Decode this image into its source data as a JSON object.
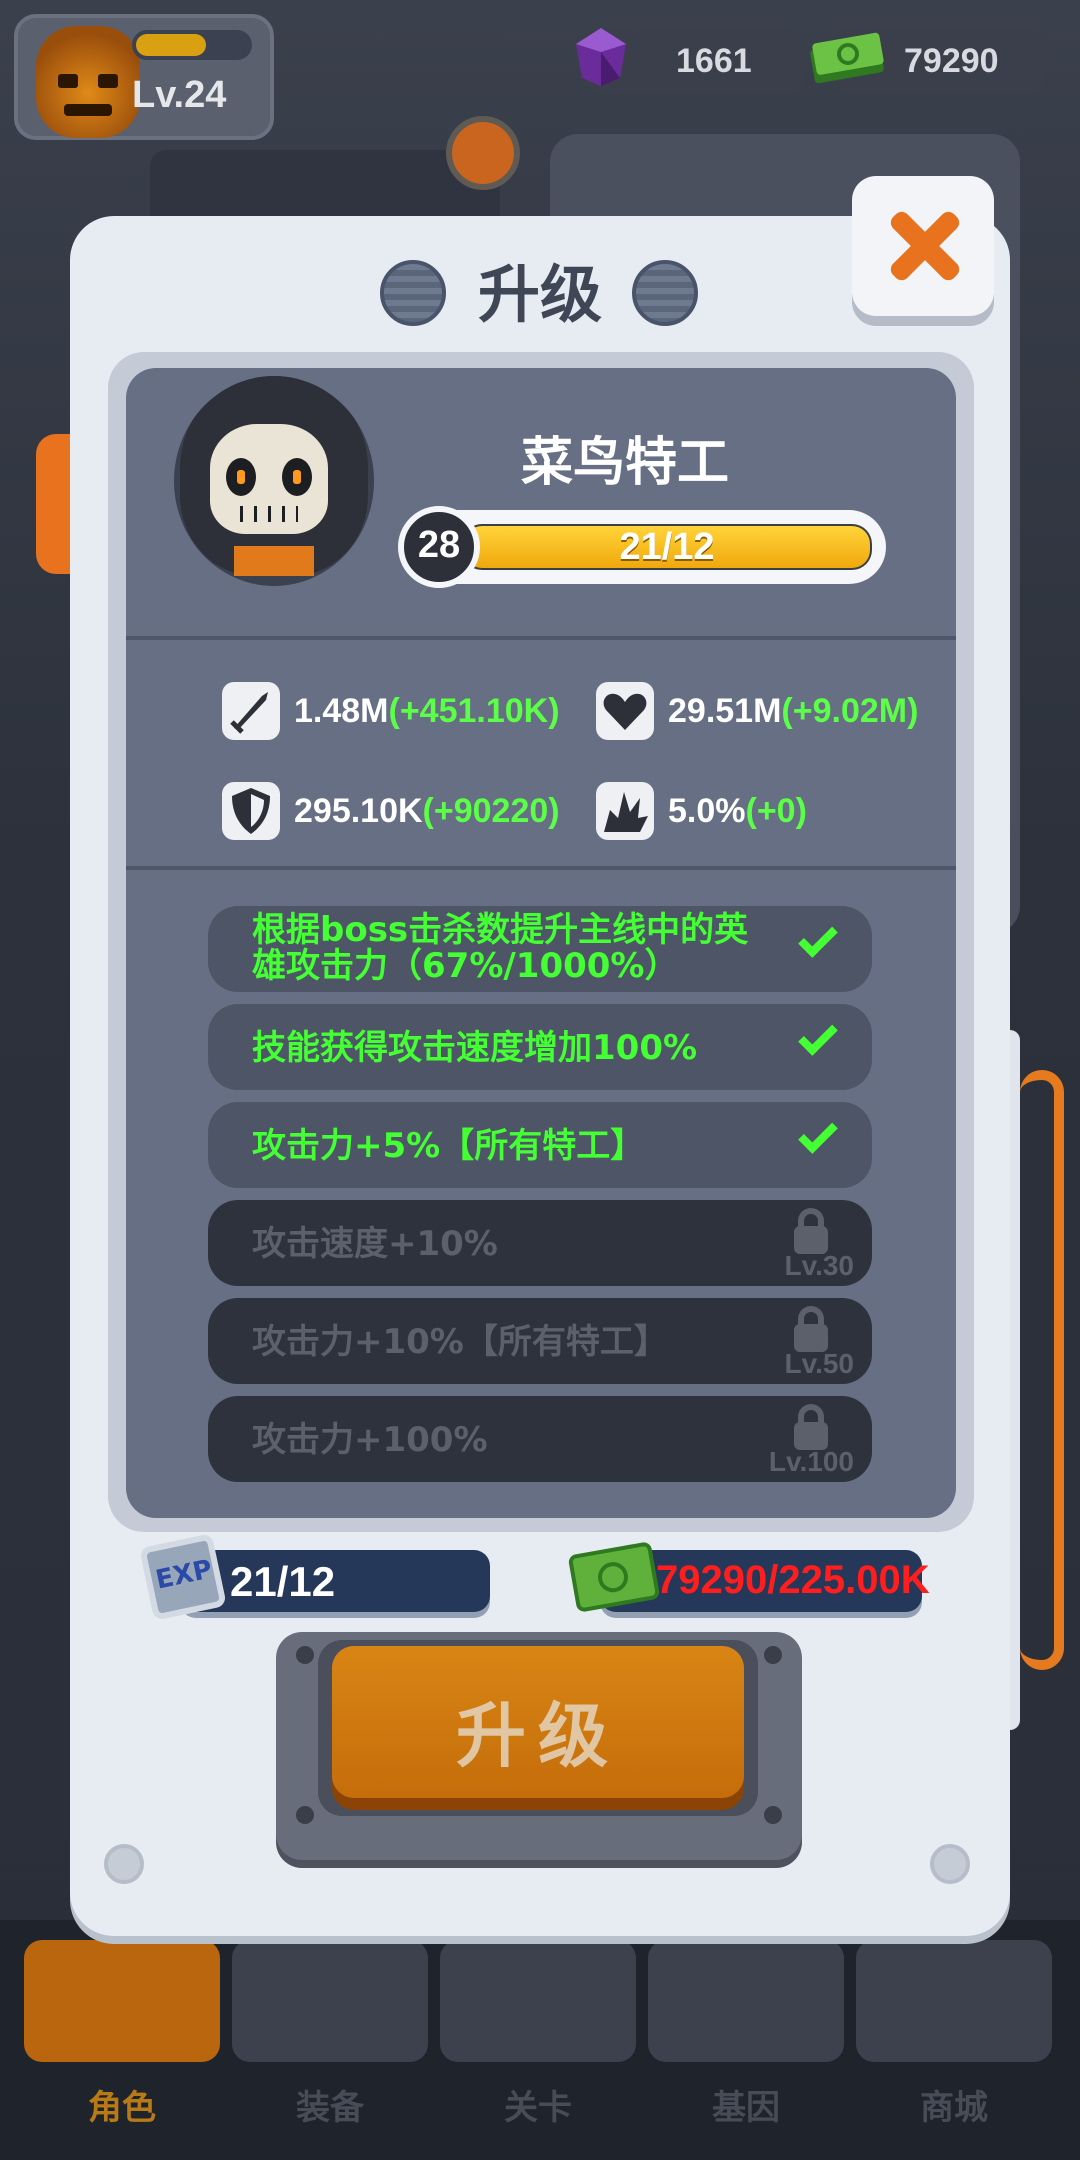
{
  "top_bar": {
    "player_level": "Lv.24",
    "gems": "1661",
    "cash": "79290"
  },
  "background": {
    "card_level": "Lv.28",
    "card_xp": "21/12",
    "card_name": "菜鸟特工"
  },
  "modal": {
    "title": "升级",
    "hero": {
      "name": "菜鸟特工",
      "level": "28",
      "xp_text": "21/12",
      "xp_fill_fraction": 1.0
    },
    "stats": [
      {
        "icon": "attack-icon",
        "base": "1.48M",
        "bonus": "(+451.10K)"
      },
      {
        "icon": "heart-icon",
        "base": "29.51M",
        "bonus": "(+9.02M)"
      },
      {
        "icon": "shield-icon",
        "base": "295.10K",
        "bonus": "(+90220)"
      },
      {
        "icon": "crit-icon",
        "base": "5.0%",
        "bonus": "(+0)"
      }
    ],
    "talents": [
      {
        "line1": "根据boss击杀数提升主线中的英",
        "line2": "雄攻击力（67%/1000%）",
        "unlocked": true,
        "level": ""
      },
      {
        "line1": "技能获得攻击速度增加100%",
        "line2": "",
        "unlocked": true,
        "level": ""
      },
      {
        "line1": "攻击力+5%【所有特工】",
        "line2": "",
        "unlocked": true,
        "level": ""
      },
      {
        "line1": "攻击速度+10%",
        "line2": "",
        "unlocked": false,
        "level": "Lv.30"
      },
      {
        "line1": "攻击力+10%【所有特工】",
        "line2": "",
        "unlocked": false,
        "level": "Lv.50"
      },
      {
        "line1": "攻击力+100%",
        "line2": "",
        "unlocked": false,
        "level": "Lv.100"
      }
    ],
    "cost": {
      "exp_icon_label": "EXP",
      "exp": "21/12",
      "cash": "79290/225.00K"
    },
    "upgrade_button": "升级"
  },
  "nav": {
    "tabs": [
      {
        "label": "角色",
        "active": true
      },
      {
        "label": "装备",
        "active": false
      },
      {
        "label": "关卡",
        "active": false
      },
      {
        "label": "基因",
        "active": false
      },
      {
        "label": "商城",
        "active": false
      }
    ]
  },
  "colors": {
    "accent_orange": "#e8721d",
    "bonus_green": "#5cff48",
    "cost_insufficient_red": "#ff1e1e",
    "xp_yellow": "#ffc61a"
  }
}
